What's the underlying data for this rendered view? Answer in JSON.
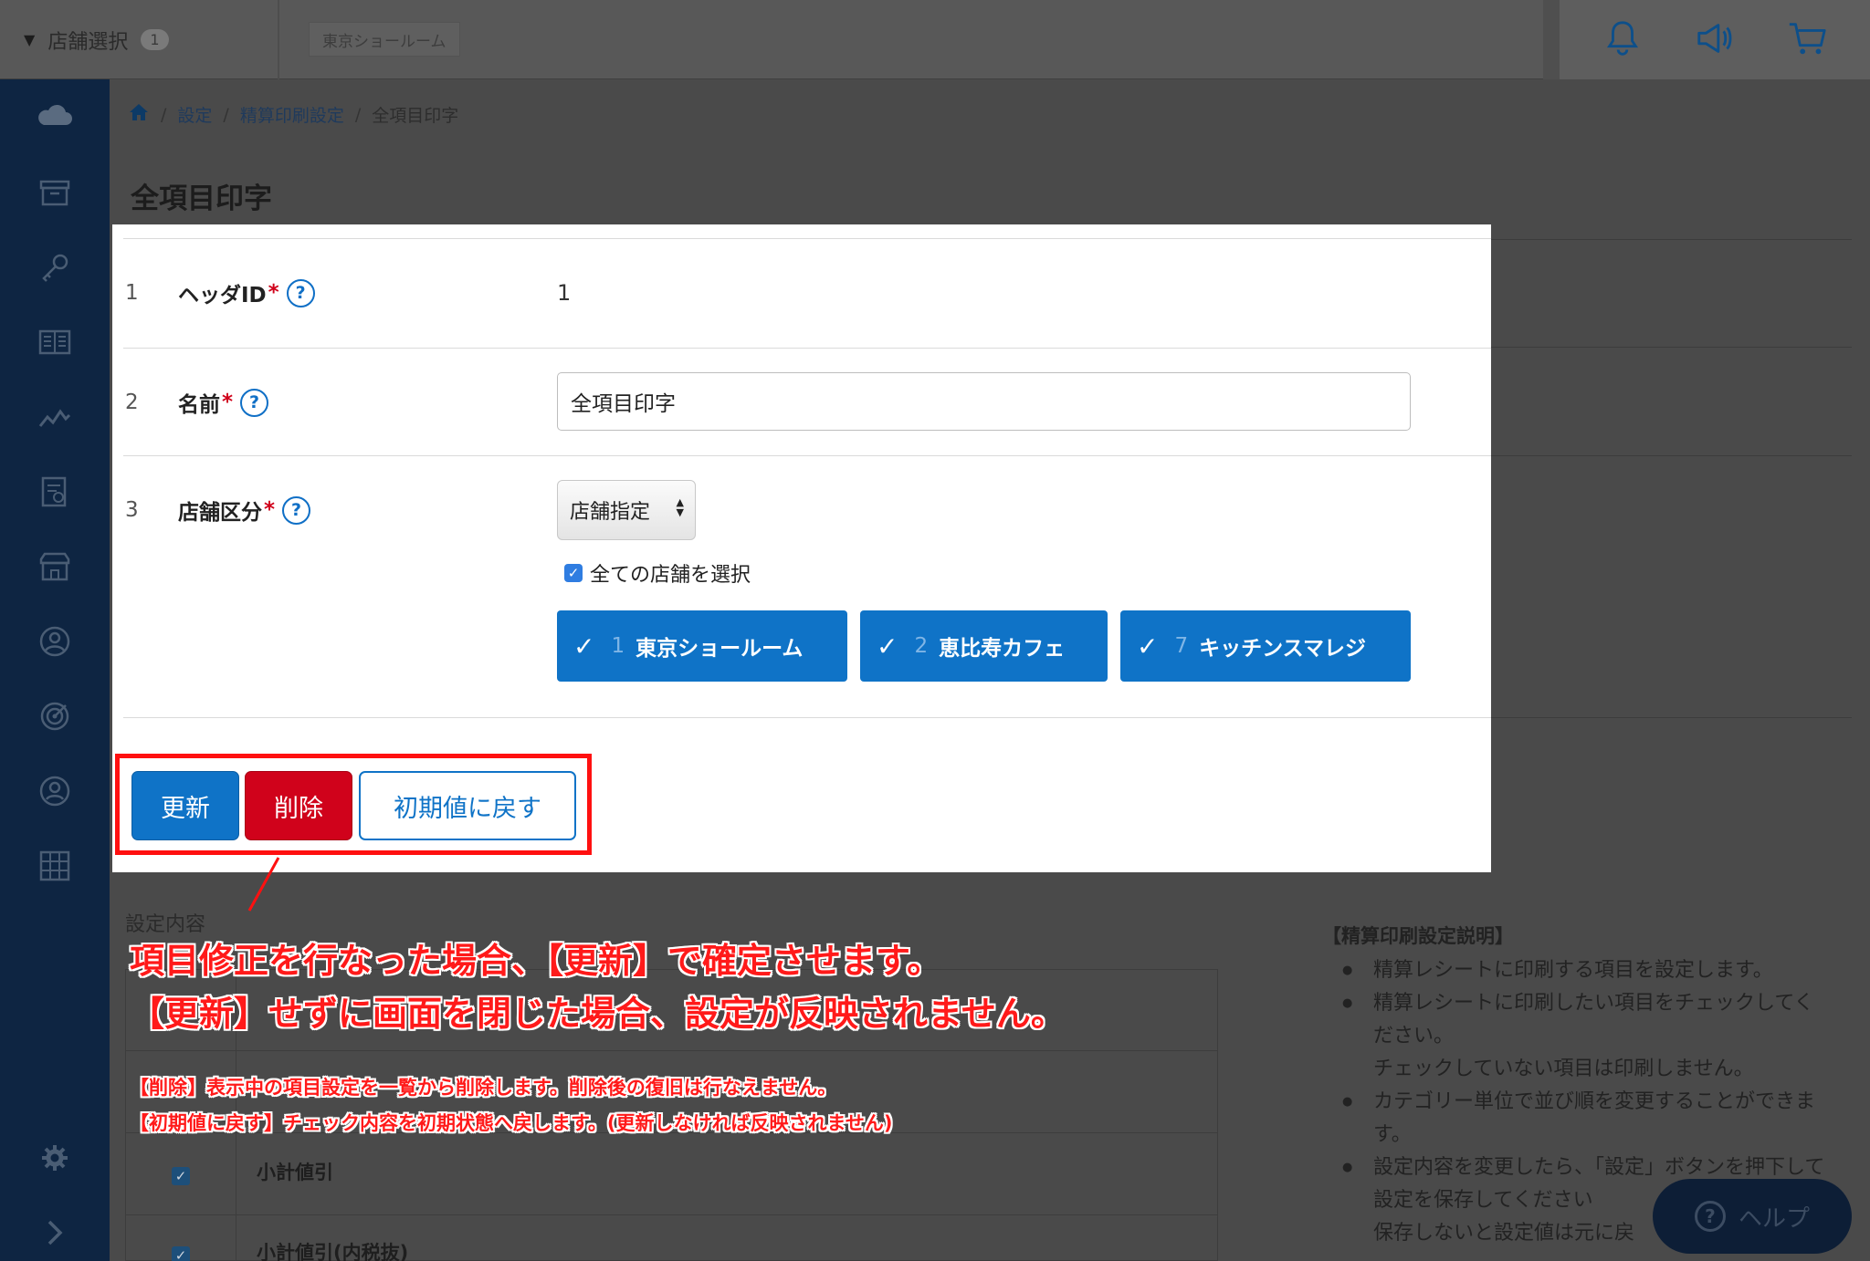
{
  "header": {
    "store_select_label": "店舗選択",
    "store_count": "1",
    "current_store": "東京ショールーム",
    "icons": [
      "bell-icon",
      "megaphone-icon",
      "cart-icon"
    ]
  },
  "sidebar": {
    "icons": [
      "cloud-icon",
      "archive-icon",
      "key-icon",
      "book-icon",
      "analytics-icon",
      "report-icon",
      "store-icon",
      "customer-icon",
      "target-icon",
      "user-icon",
      "grid-icon",
      "gear-icon",
      "expand-chevron-icon"
    ]
  },
  "breadcrumb": {
    "items": [
      "設定",
      "精算印刷設定"
    ],
    "current": "全項目印字",
    "separator": "/"
  },
  "page": {
    "title": "全項目印字"
  },
  "form": {
    "rows": [
      {
        "num": "1",
        "label": "ヘッダID",
        "value": "1"
      },
      {
        "num": "2",
        "label": "名前",
        "value": "全項目印字"
      },
      {
        "num": "3",
        "label": "店舗区分",
        "select_value": "店舗指定"
      }
    ],
    "required_mark": "*",
    "help_mark": "?",
    "select_all_label": "全ての店舗を選択",
    "stores": [
      {
        "num": "1",
        "name": "東京ショールーム"
      },
      {
        "num": "2",
        "name": "恵比寿カフェ"
      },
      {
        "num": "7",
        "name": "キッチンスマレジ"
      }
    ]
  },
  "actions": {
    "update": "更新",
    "delete": "削除",
    "reset": "初期値に戻す"
  },
  "settings": {
    "section_title": "設定内容",
    "rows": [
      "小計値引",
      "小計値引(内税抜)"
    ]
  },
  "explanation": {
    "title": "【精算印刷設定説明】",
    "items": [
      "精算レシートに印刷する項目を設定します。",
      "精算レシートに印刷したい項目をチェックしてください。\nチェックしていない項目は印刷しません。",
      "カテゴリー単位で並び順を変更することができます。",
      "設定内容を変更したら、「設定」ボタンを押下して設定を保存してください\n保存しないと設定値は元に戻"
    ]
  },
  "help_button": {
    "label": "ヘルプ"
  },
  "annotations": {
    "line1": "項目修正を行なった場合、【更新】で確定させます。",
    "line2": "【更新】せずに画面を閉じた場合、設定が反映されません。",
    "line3": "【削除】表示中の項目設定を一覧から削除します。削除後の復旧は行なえません。",
    "line4": "【初期値に戻す】チェック内容を初期状態へ戻します。(更新しなければ反映されません)",
    "color": "#ff1a1a"
  },
  "colors": {
    "primary": "#0f73c7",
    "danger": "#d0021b",
    "sidebar": "#0e2542",
    "annotation": "#ff1a1a"
  }
}
